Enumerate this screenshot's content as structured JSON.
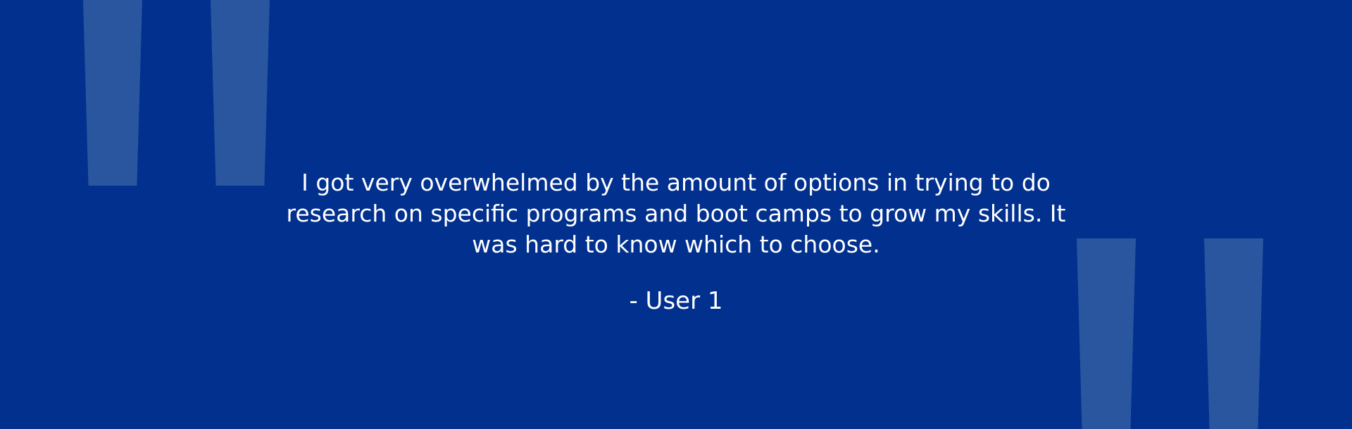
{
  "testimonial": {
    "quote": "I got very overwhelmed by the amount of options in trying to do research on specific programs and boot camps to grow my skills. It was hard to know which to choose.",
    "author": "- User 1"
  },
  "colors": {
    "background": "#01308e",
    "quote_marks": "#2a56a0",
    "text": "#ffffff"
  },
  "icons": [
    "open-quote-icon",
    "close-quote-icon"
  ]
}
